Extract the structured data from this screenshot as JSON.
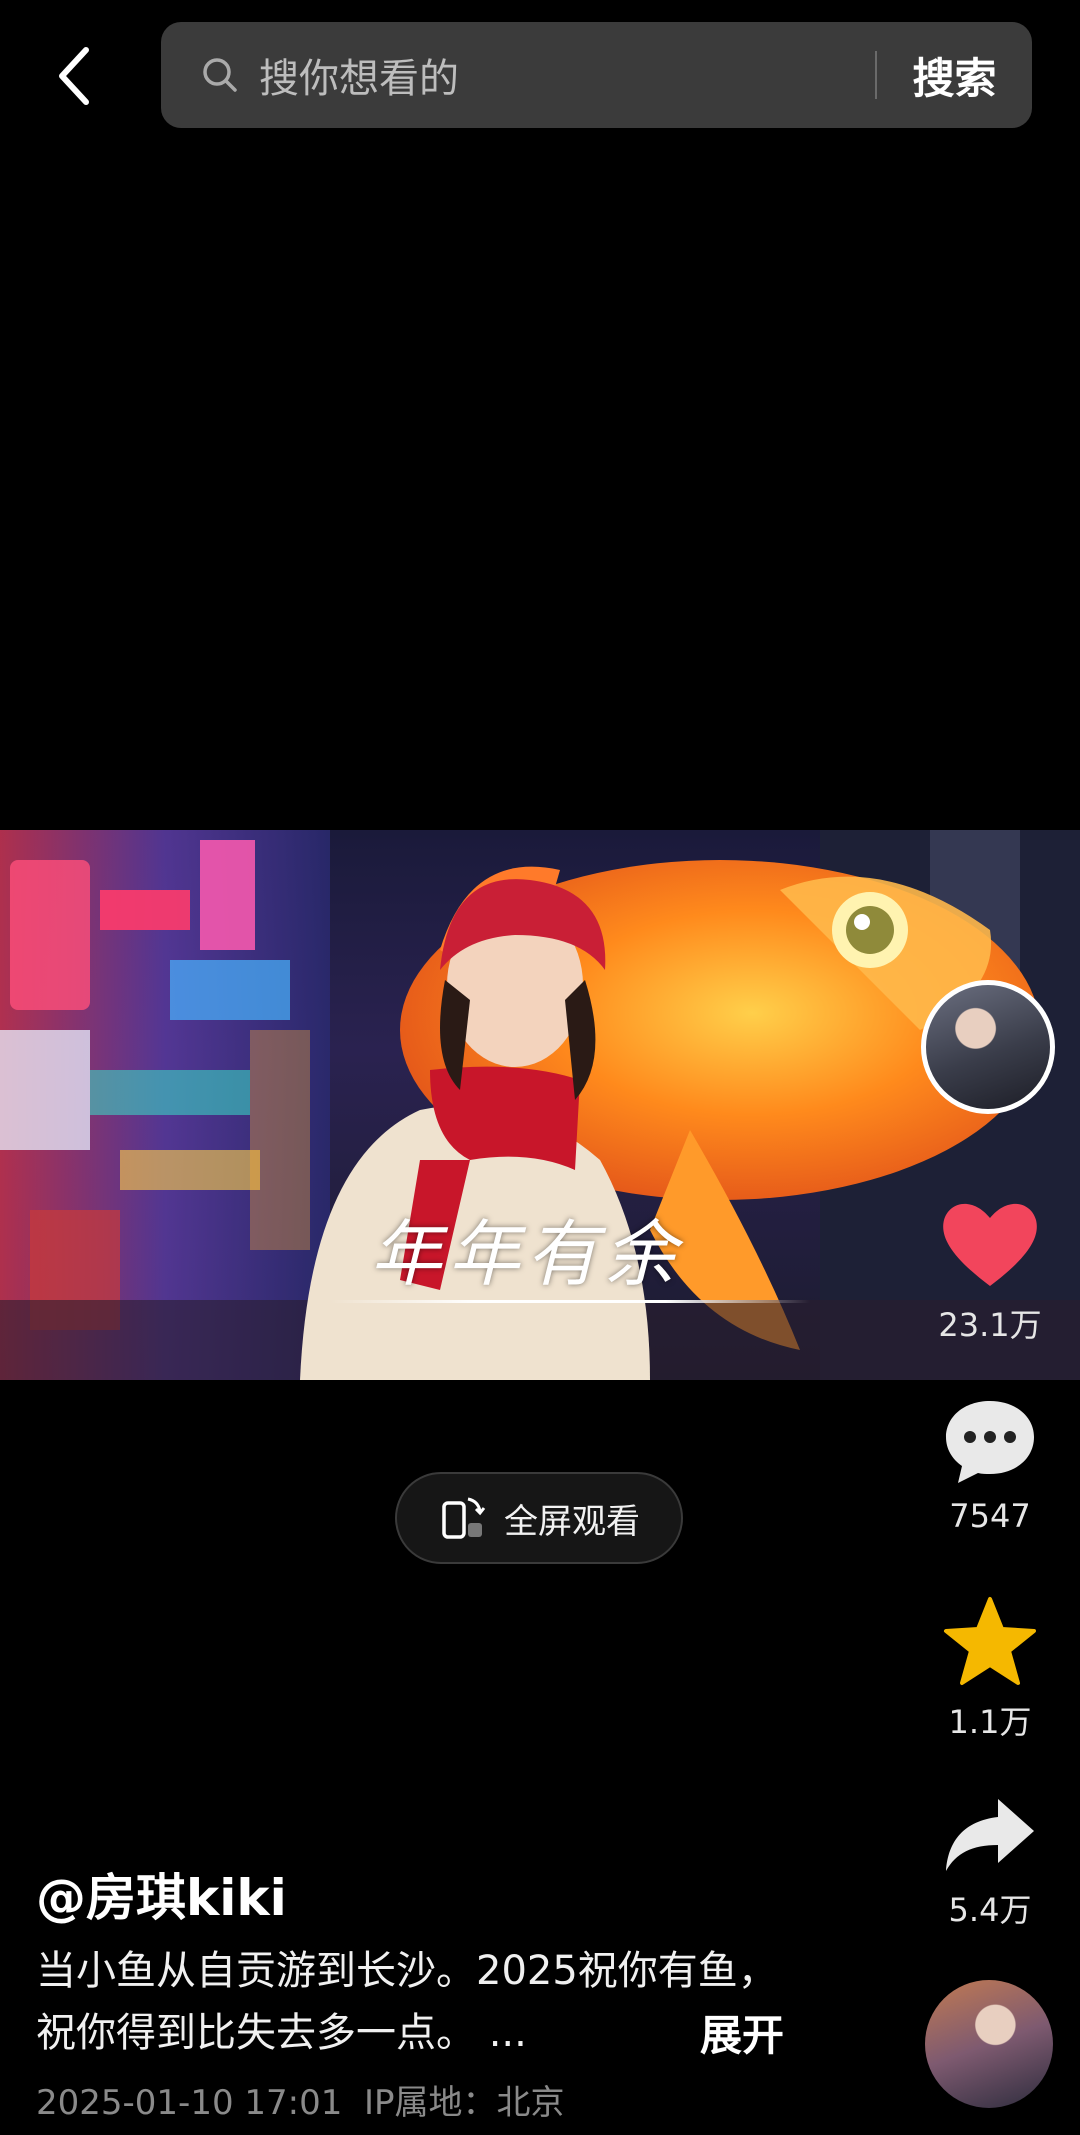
{
  "header": {
    "search_placeholder": "搜你想看的",
    "search_button": "搜索"
  },
  "video": {
    "caption": "年年有余"
  },
  "actions": {
    "likes": "23.1万",
    "comments": "7547",
    "favorites": "1.1万",
    "shares": "5.4万"
  },
  "fullscreen_label": "全屏观看",
  "post": {
    "author": "@房琪kiki",
    "description": "当小鱼从自贡游到长沙。2025祝你有鱼，祝你得到比失去多一点。 ...",
    "expand_label": "展开",
    "timestamp": "2025-01-10 17:01",
    "ip_location": "IP属地：北京"
  },
  "colors": {
    "like_red": "#f2455c",
    "favorite_gold": "#f5b800",
    "search_bg": "#3b3b3b"
  },
  "icons": [
    "back-arrow-icon",
    "search-icon",
    "heart-icon",
    "comment-icon",
    "star-icon",
    "share-icon",
    "fullscreen-icon"
  ]
}
